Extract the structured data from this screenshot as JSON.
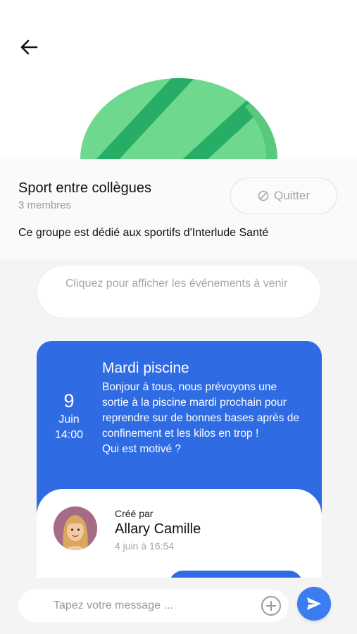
{
  "header": {
    "back_icon": "arrow-left-icon"
  },
  "group": {
    "name": "Sport entre collègues",
    "members": "3 membres",
    "quit_label": "Quitter",
    "quit_icon": "block-icon",
    "description": "Ce groupe est dédié aux sportifs d'Interlude Santé"
  },
  "events_button": {
    "label": "Cliquez pour afficher les événements à venir"
  },
  "event": {
    "day": "9",
    "month": "Juin",
    "time": "14:00",
    "title": "Mardi piscine",
    "body": "Bonjour à tous, nous prévoyons une sortie à la piscine mardi prochain pour reprendre sur de bonnes bases après de confinement et les kilos en trop !\nQui est motivé ?",
    "created_by_label": "Créé par",
    "creator_name": "Allary Camille",
    "created_date": "4 juin à 16:54"
  },
  "composer": {
    "placeholder": "Tapez votre message ...",
    "add_icon": "plus-circle-icon",
    "send_icon": "send-icon"
  },
  "colors": {
    "accent": "#2f6be3",
    "send": "#3b7cf0",
    "banner_green": "#6ed88f",
    "banner_stripe": "#27ad66"
  }
}
